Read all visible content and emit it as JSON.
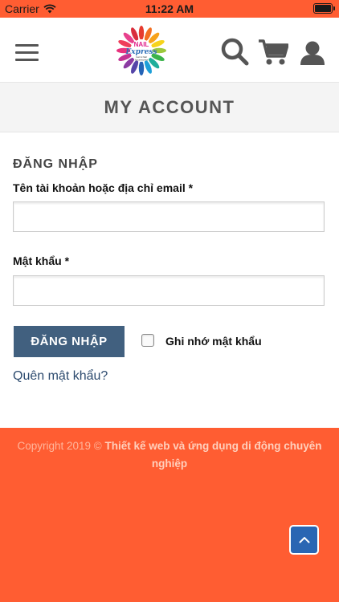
{
  "status_bar": {
    "carrier": "Carrier",
    "time": "11:22 AM"
  },
  "header": {
    "menu_icon": "hamburger-menu-icon",
    "logo": {
      "text_main": "NAIL",
      "text_script": "Express",
      "tagline_1": "Gel & Nail",
      "tagline_2": "Accessories"
    },
    "search_icon": "search-icon",
    "cart_icon": "cart-icon",
    "account_icon": "user-icon"
  },
  "page": {
    "title": "MY ACCOUNT"
  },
  "login_form": {
    "heading": "ĐĂNG NHẬP",
    "username_label": "Tên tài khoản hoặc địa chỉ email *",
    "username_value": "",
    "password_label": "Mật khẩu *",
    "password_value": "",
    "submit_label": "ĐĂNG NHẬP",
    "remember_label": "Ghi nhớ mật khẩu",
    "remember_checked": false,
    "forgot_link": "Quên mật khẩu?"
  },
  "footer": {
    "copyright_prefix": "Copyright 2019 ©",
    "copyright_link": "Thiết kế web và ứng dụng di động chuyên nghiệp"
  },
  "back_to_top_icon": "chevron-up-icon",
  "colors": {
    "accent_orange": "#ff5d32",
    "button_blue": "#41607f",
    "back_to_top_blue": "#2a66b3"
  }
}
